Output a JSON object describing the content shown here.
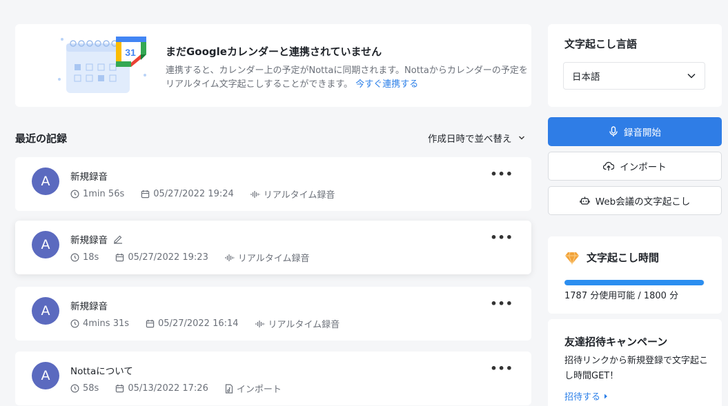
{
  "banner": {
    "title": "まだGoogleカレンダーと連携されていません",
    "desc": "連携すると、カレンダー上の予定がNottaに同期されます。Nottaからカレンダーの予定をリアルタイム文字起こしすることができます。",
    "link": "今すぐ連携する",
    "calendar_day": "31"
  },
  "records_section": {
    "title": "最近の記録",
    "sort_label": "作成日時で並べ替え"
  },
  "records": [
    {
      "avatar": "A",
      "title": "新規録音",
      "duration": "1min 56s",
      "date": "05/27/2022 19:24",
      "type": "リアルタイム録音",
      "type_icon": "waveform-icon"
    },
    {
      "avatar": "A",
      "title": "新規録音",
      "duration": "18s",
      "date": "05/27/2022 19:23",
      "type": "リアルタイム録音",
      "type_icon": "waveform-icon"
    },
    {
      "avatar": "A",
      "title": "新規録音",
      "duration": "4mins 31s",
      "date": "05/27/2022 16:14",
      "type": "リアルタイム録音",
      "type_icon": "waveform-icon"
    },
    {
      "avatar": "A",
      "title": "Nottaについて",
      "duration": "58s",
      "date": "05/13/2022 17:26",
      "type": "インポート",
      "type_icon": "file-music-icon"
    }
  ],
  "language": {
    "title": "文字起こし言語",
    "selected": "日本語"
  },
  "actions": {
    "record": "録音開始",
    "import": "インポート",
    "web_meeting": "Web会議の文字起こし"
  },
  "time": {
    "title": "文字起こし時間",
    "usage_text": "1787 分使用可能 / 1800 分",
    "available": 1787,
    "total": 1800
  },
  "invite": {
    "title": "友達招待キャンペーン",
    "desc": "招待リンクから新規登録で文字起こし時間GET！",
    "link": "招待する"
  },
  "colors": {
    "accent": "#2f7de6",
    "avatar": "#5b6abf",
    "link": "#2b7fe8",
    "progress": "#2b8ef0",
    "diamond": "#f2a33a"
  }
}
